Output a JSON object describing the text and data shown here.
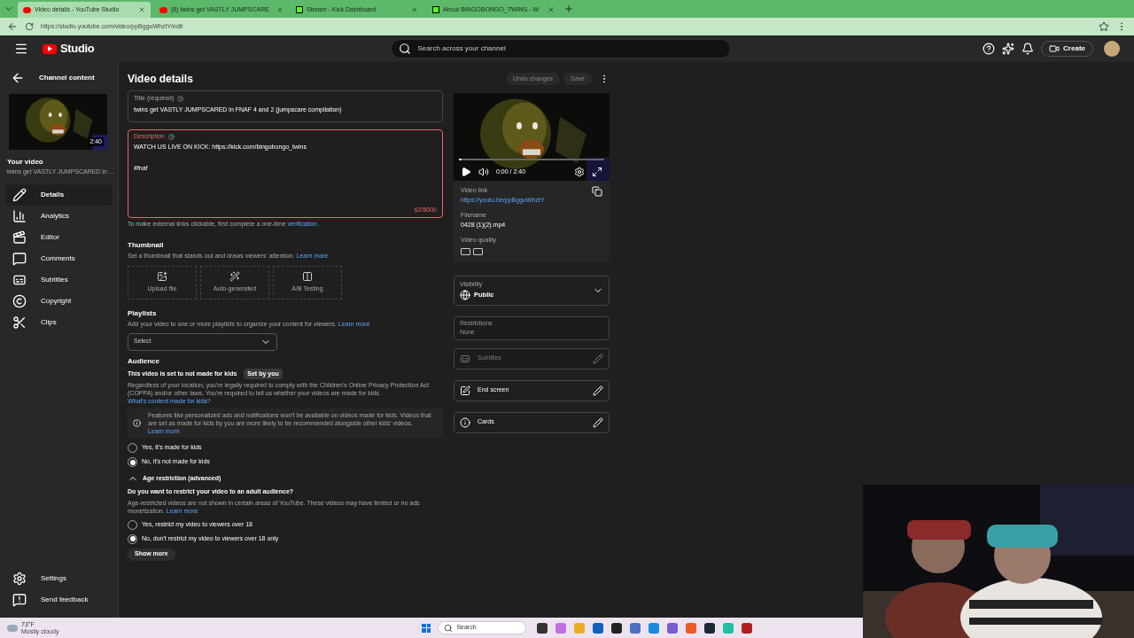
{
  "browser": {
    "tabs": [
      {
        "title": "Video details - YouTube Studio",
        "selected": true,
        "kind": "youtube"
      },
      {
        "title": "(8) twins get VASTLY JUMPSCARE",
        "selected": false,
        "kind": "youtube"
      },
      {
        "title": "Stream - Kick Dashboard",
        "selected": false,
        "kind": "kick"
      },
      {
        "title": "About BINGOBONGO_TWINS - W",
        "selected": false,
        "kind": "kick"
      }
    ],
    "url": "https://studio.youtube.com/video/ppBgguWhztY/edit"
  },
  "header": {
    "logo": "Studio",
    "search_placeholder": "Search across your channel",
    "create": "Create"
  },
  "sidebar": {
    "back": "Channel content",
    "duration": "2:40",
    "your_video": "Your video",
    "video_title": "twins get VASTLY JUMPSCARED in ...",
    "items": [
      {
        "label": "Details",
        "selected": true,
        "kind": "details"
      },
      {
        "label": "Analytics",
        "selected": false,
        "kind": "analytics"
      },
      {
        "label": "Editor",
        "selected": false,
        "kind": "editor"
      },
      {
        "label": "Comments",
        "selected": false,
        "kind": "comments"
      },
      {
        "label": "Subtitles",
        "selected": false,
        "kind": "subtitles"
      },
      {
        "label": "Copyright",
        "selected": false,
        "kind": "copyright"
      },
      {
        "label": "Clips",
        "selected": false,
        "kind": "clips"
      }
    ],
    "bottom": [
      {
        "label": "Settings",
        "kind": "settings"
      },
      {
        "label": "Send feedback",
        "kind": "feedback"
      }
    ]
  },
  "main": {
    "heading": "Video details",
    "undo": "Undo changes",
    "save": "Save",
    "title_field": {
      "label": "Title (required)",
      "value": "twins get VASTLY JUMPSCARED in FNAF 4 and 2 (jumpscare compilation)"
    },
    "description": {
      "label": "Description",
      "lines": [
        "WATCH US LIVE ON KICK: https://kick.com/bingobongo_twins",
        "#fnaf"
      ],
      "count": "62/5000"
    },
    "verify_note": "To make external links clickable, first complete a one-time",
    "verify_link": "verification.",
    "thumbnail": {
      "heading": "Thumbnail",
      "desc": "Set a thumbnail that stands out and draws viewers' attention.",
      "link": "Learn more",
      "options": [
        {
          "label": "Upload file",
          "kind": "upload"
        },
        {
          "label": "Auto-generated",
          "kind": "auto"
        },
        {
          "label": "A/B Testing",
          "kind": "ab"
        }
      ]
    },
    "playlists": {
      "heading": "Playlists",
      "desc": "Add your video to one or more playlists to organize your content for viewers.",
      "link": "Learn more",
      "select": "Select"
    },
    "audience": {
      "heading": "Audience",
      "status": "This video is set to not made for kids",
      "badge": "Set by you",
      "desc": "Regardless of your location, you're legally required to comply with the Children's Online Privacy Protection Act (COPPA) and/or other laws. You're required to tell us whether your videos are made for kids.",
      "desc_link": "What's content made for kids?",
      "info": "Features like personalized ads and notifications won't be available on videos made for kids. Videos that are set as made for kids by you are more likely to be recommended alongside other kids' videos.",
      "info_link": "Learn more",
      "options": [
        {
          "label": "Yes, it's made for kids",
          "selected": false
        },
        {
          "label": "No, it's not made for kids",
          "selected": true
        }
      ]
    },
    "age": {
      "heading": "Age restriction (advanced)",
      "expanded": true,
      "question": "Do you want to restrict your video to an adult audience?",
      "desc": "Age-restricted videos are not shown in certain areas of YouTube. These videos may have limited or no ads monetization.",
      "link": "Learn more",
      "options": [
        {
          "label": "Yes, restrict my video to viewers over 18",
          "selected": false
        },
        {
          "label": "No, don't restrict my video to viewers over 18 only",
          "selected": true
        }
      ]
    },
    "show_more": "Show more"
  },
  "panel": {
    "progress": {
      "level": 0.02
    },
    "time": "0:00 / 2:40",
    "link_label": "Video link",
    "link": "https://youtu.be/ppBgguWhztY",
    "filename_label": "Filename",
    "filename": "0428 (1)(2).mp4",
    "quality_label": "Video quality",
    "visibility_label": "Visibility",
    "visibility": "Public",
    "restrictions_label": "Restrictions",
    "restrictions": "None",
    "rows": [
      {
        "label": "Subtitles",
        "kind": "subtitles",
        "disabled": true
      },
      {
        "label": "End screen",
        "kind": "endscreen",
        "disabled": false
      },
      {
        "label": "Cards",
        "kind": "cards",
        "disabled": false
      }
    ]
  },
  "taskbar": {
    "temp": "73°F",
    "weather": "Mostly cloudy",
    "search": "Search"
  }
}
